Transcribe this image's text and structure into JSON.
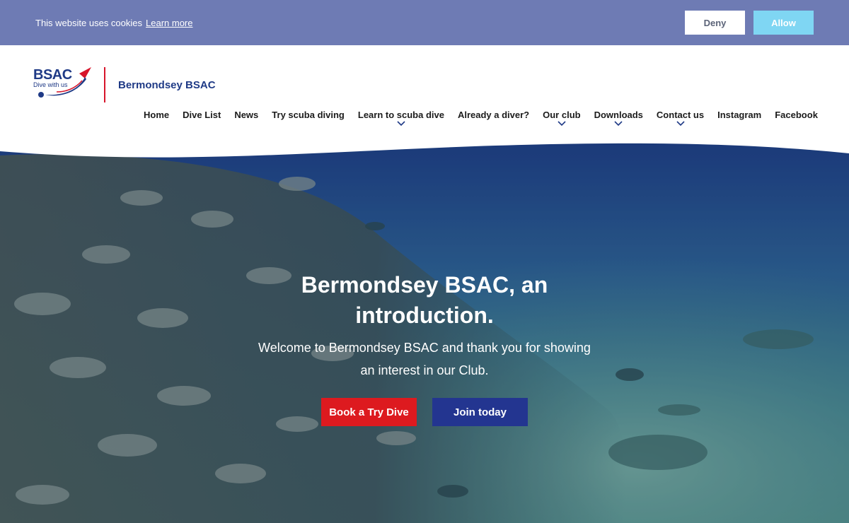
{
  "cookie_banner": {
    "text": "This website uses cookies",
    "learn_more": "Learn more",
    "deny_label": "Deny",
    "allow_label": "Allow",
    "background": "#6e7bb4",
    "allow_color": "#7fd6f3"
  },
  "header": {
    "logo": {
      "wordmark": "BSAC",
      "tagline": "Dive with us"
    },
    "site_name": "Bermondsey BSAC",
    "nav": [
      {
        "label": "Home",
        "has_dropdown": false
      },
      {
        "label": "Dive List",
        "has_dropdown": false
      },
      {
        "label": "News",
        "has_dropdown": false
      },
      {
        "label": "Try scuba diving",
        "has_dropdown": false
      },
      {
        "label": "Learn to scuba dive",
        "has_dropdown": true
      },
      {
        "label": "Already a diver?",
        "has_dropdown": false
      },
      {
        "label": "Our club",
        "has_dropdown": true
      },
      {
        "label": "Downloads",
        "has_dropdown": true
      },
      {
        "label": "Contact us",
        "has_dropdown": true
      },
      {
        "label": "Instagram",
        "has_dropdown": false
      },
      {
        "label": "Facebook",
        "has_dropdown": false
      }
    ],
    "chevron_icon": "chevron-down-icon",
    "accent": "#1f3a86"
  },
  "hero": {
    "title_line1": "Bermondsey BSAC, an",
    "title_line2": "introduction.",
    "subtitle_line1": "Welcome to Bermondsey BSAC and thank you for showing",
    "subtitle_line2": "an interest in our Club.",
    "primary_button": "Book a Try Dive",
    "secondary_button": "Join today",
    "primary_color": "#dd1a1f",
    "secondary_color": "#233590"
  }
}
